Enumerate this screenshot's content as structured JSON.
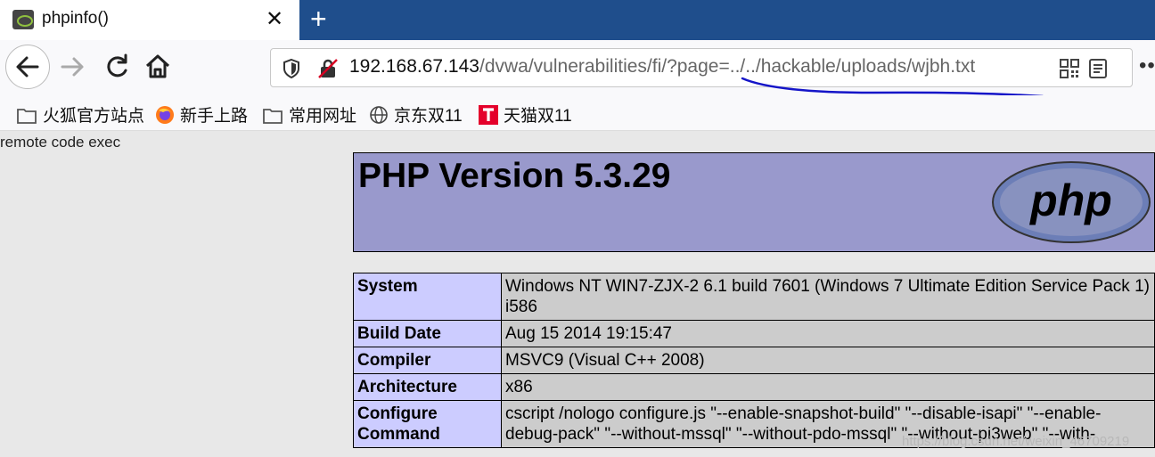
{
  "browser": {
    "tab": {
      "title": "phpinfo()",
      "close": "✕"
    },
    "new_tab": "+",
    "url": {
      "host": "192.168.67.143",
      "path": "/dvwa/vulnerabilities/fi/?page=../../hackable/uploads/wjbh.txt"
    },
    "bookmarks": [
      {
        "label": "火狐官方站点",
        "icon": "folder-icon"
      },
      {
        "label": "新手上路",
        "icon": "firefox-icon"
      },
      {
        "label": "常用网址",
        "icon": "folder-icon"
      },
      {
        "label": "京东双11",
        "icon": "globe-icon"
      },
      {
        "label": "天猫双11",
        "icon": "tmall-icon"
      }
    ],
    "annotation_color": "#1515c8"
  },
  "page": {
    "output_text": "remote code exec",
    "php_title": "PHP Version 5.3.29",
    "logo_text": "php",
    "rows": [
      {
        "key": "System",
        "value": "Windows NT WIN7-ZJX-2 6.1 build 7601 (Windows 7 Ultimate Edition Service Pack 1) i586"
      },
      {
        "key": "Build Date",
        "value": "Aug 15 2014 19:15:47"
      },
      {
        "key": "Compiler",
        "value": "MSVC9 (Visual C++ 2008)"
      },
      {
        "key": "Architecture",
        "value": "x86"
      },
      {
        "key": "Configure Command",
        "value": "cscript /nologo configure.js \"--enable-snapshot-build\" \"--disable-isapi\" \"--enable-debug-pack\" \"--without-mssql\" \"--without-pdo-mssql\" \"--without-pi3web\" \"--with-"
      }
    ],
    "watermark": "https://blog.csdn.net/weixin_46709219"
  },
  "colors": {
    "tabstrip": "#1f4e8c",
    "php_header": "#9999cc",
    "key_cell": "#ccccff",
    "value_cell": "#cccccc"
  }
}
